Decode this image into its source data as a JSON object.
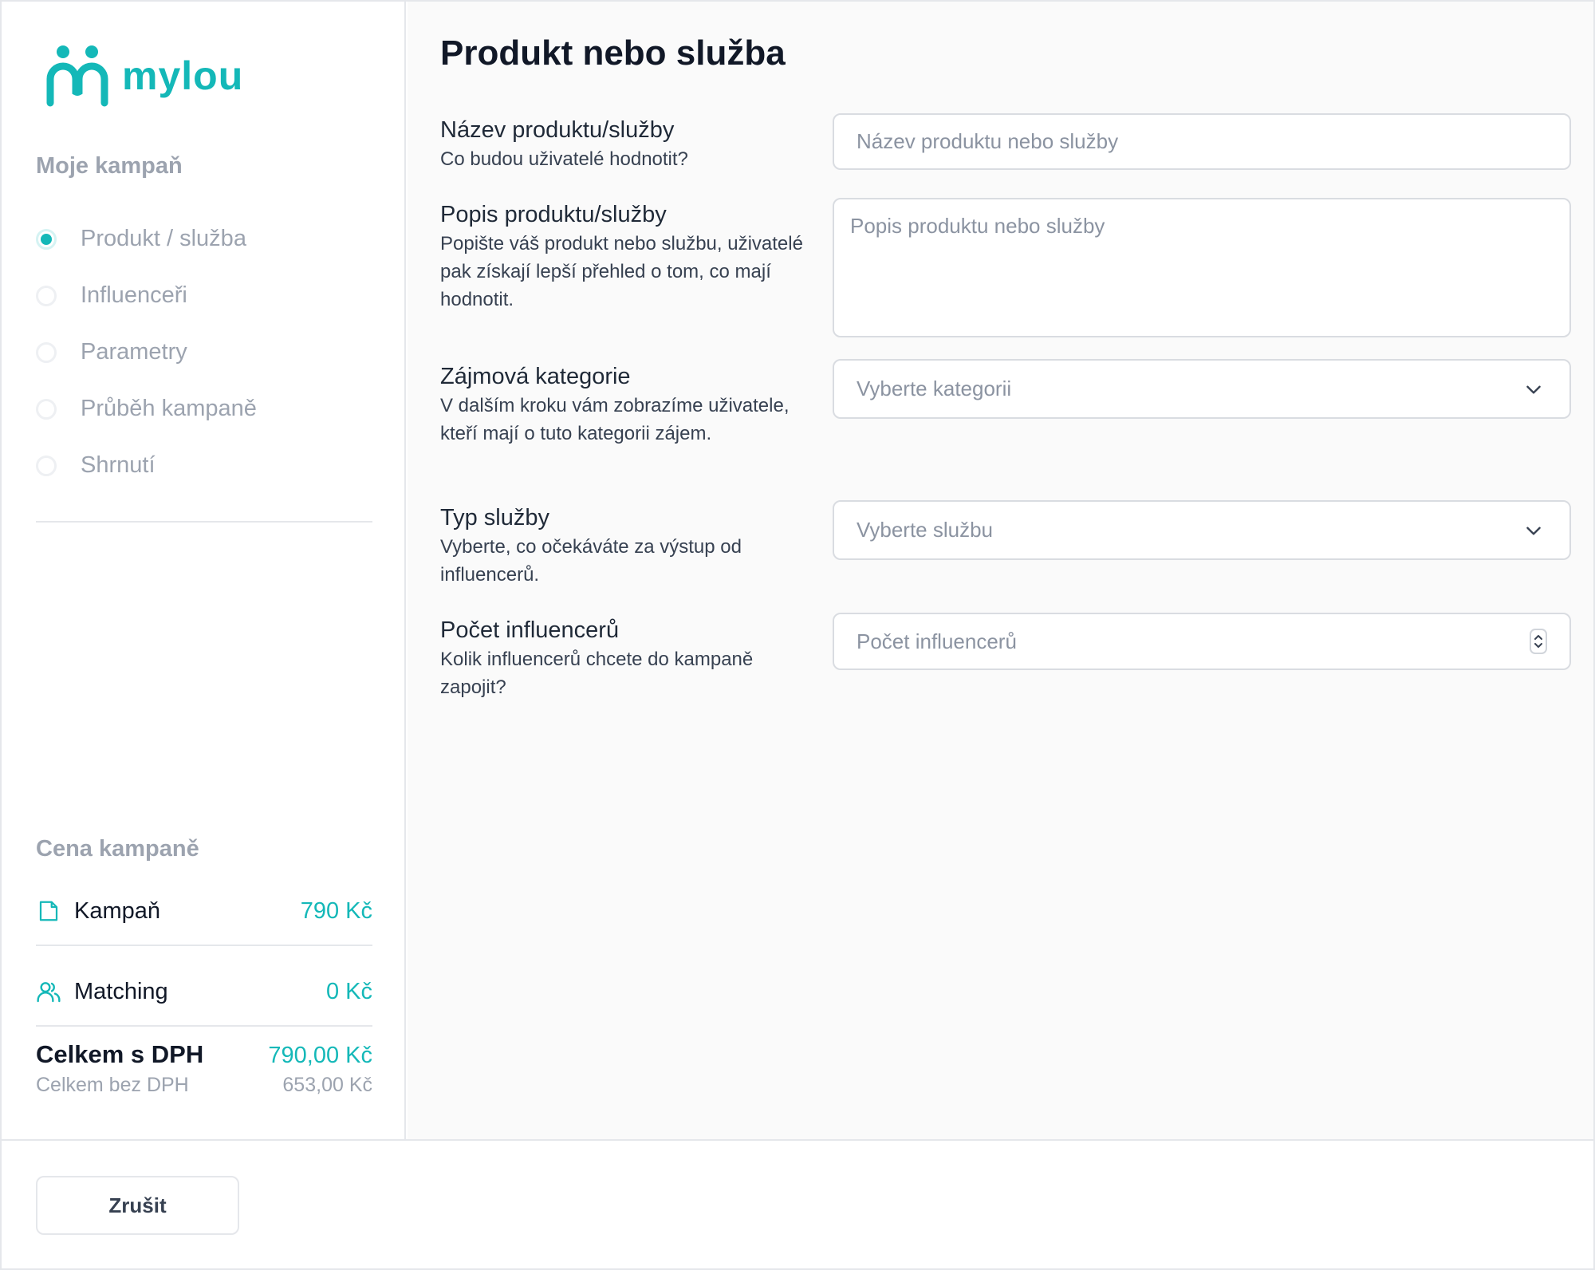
{
  "brand": {
    "name": "mylou",
    "accent": "#14b8b8"
  },
  "sidebar": {
    "section_title": "Moje kampaň",
    "steps": [
      {
        "label": "Produkt / služba",
        "active": true
      },
      {
        "label": "Influenceři",
        "active": false
      },
      {
        "label": "Parametry",
        "active": false
      },
      {
        "label": "Průběh kampaně",
        "active": false
      },
      {
        "label": "Shrnutí",
        "active": false
      }
    ],
    "price_title": "Cena kampaně",
    "price_items": [
      {
        "icon": "file-icon",
        "label": "Kampaň",
        "value": "790 Kč"
      },
      {
        "icon": "users-icon",
        "label": "Matching",
        "value": "0 Kč"
      }
    ],
    "total": {
      "label": "Celkem s DPH",
      "value": "790,00 Kč"
    },
    "subtotal": {
      "label": "Celkem bez DPH",
      "value": "653,00 Kč"
    }
  },
  "main": {
    "title": "Produkt nebo služba",
    "fields": [
      {
        "title": "Název produktu/služby",
        "description": "Co budou uživatelé hodnotit?",
        "placeholder": "Název produktu nebo služby"
      },
      {
        "title": "Popis produktu/služby",
        "description": "Popište váš produkt nebo službu, uživatelé pak získají lepší přehled o tom, co mají hodnotit.",
        "placeholder": "Popis produktu nebo služby"
      },
      {
        "title": "Zájmová kategorie",
        "description": "V dalším kroku vám zobrazíme uživatele, kteří mají o tuto kategorii zájem.",
        "placeholder": "Vyberte kategorii"
      },
      {
        "title": "Typ služby",
        "description": "Vyberte, co očekáváte za výstup od influencerů.",
        "placeholder": "Vyberte službu"
      },
      {
        "title": "Počet influencerů",
        "description": "Kolik influencerů chcete do kampaně zapojit?",
        "placeholder": "Počet influencerů"
      }
    ]
  },
  "footer": {
    "cancel_label": "Zrušit"
  }
}
